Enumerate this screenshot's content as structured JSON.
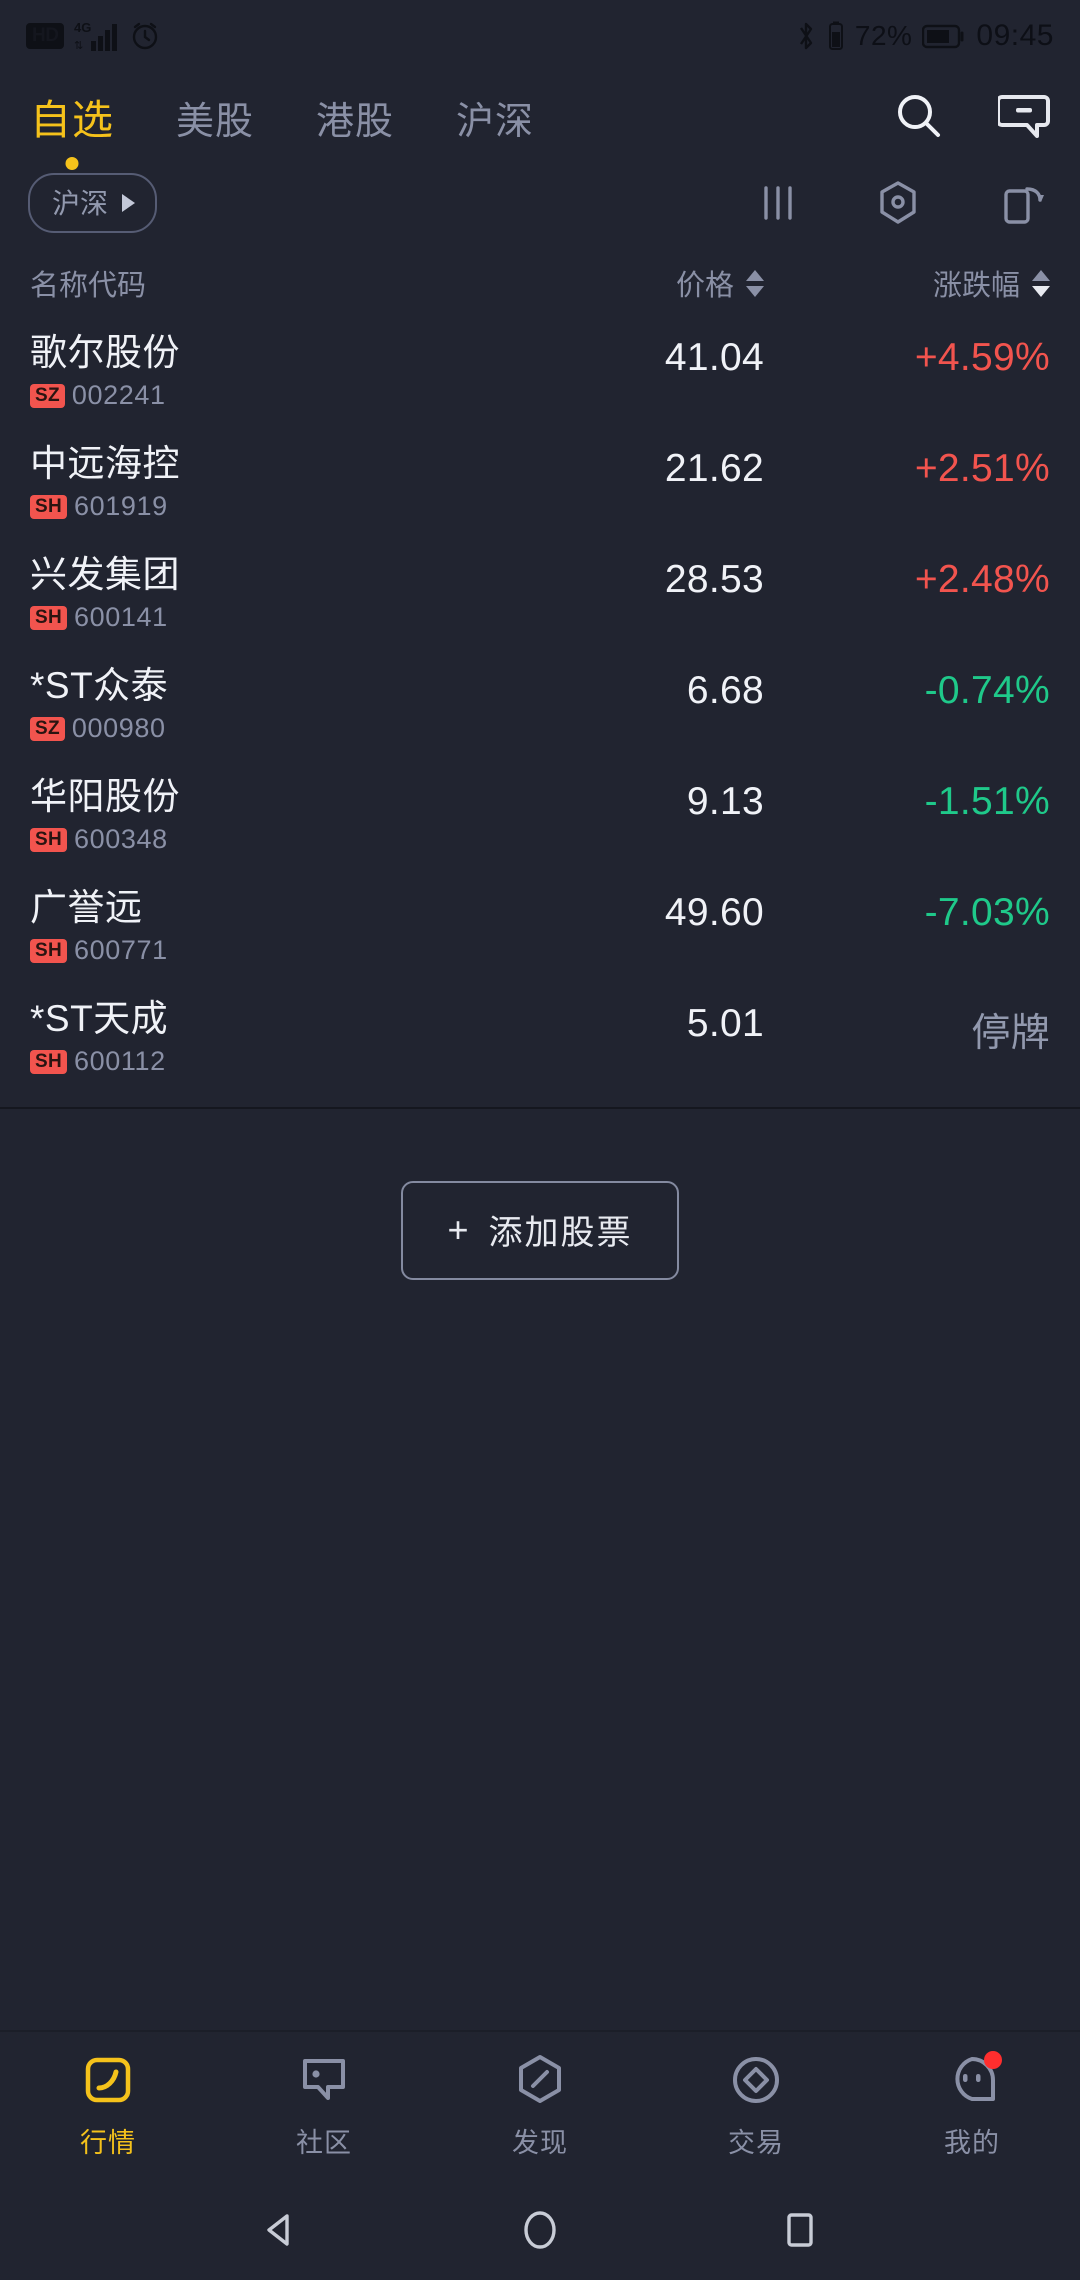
{
  "status_bar": {
    "hd_label": "HD",
    "network_label": "4G",
    "icons": [
      "hd-icon",
      "signal-4g-icon",
      "alarm-icon",
      "bluetooth-icon",
      "battery-small-icon",
      "battery-icon"
    ],
    "battery_percent": "72%",
    "time": "09:45"
  },
  "header": {
    "tabs": [
      {
        "label": "自选",
        "active": true
      },
      {
        "label": "美股",
        "active": false
      },
      {
        "label": "港股",
        "active": false
      },
      {
        "label": "沪深",
        "active": false
      }
    ],
    "search_icon": "search-icon",
    "message_icon": "message-icon"
  },
  "filter_bar": {
    "chip_label": "沪深",
    "chip_arrow": "play-triangle-icon",
    "icons": [
      "columns-icon",
      "hexagon-target-icon",
      "rotate-screen-icon"
    ]
  },
  "table": {
    "headers": {
      "name": "名称代码",
      "price": "价格",
      "change": "涨跌幅"
    },
    "sort": {
      "price_active": false,
      "change_active": true,
      "direction": "desc"
    },
    "rows": [
      {
        "name": "歌尔股份",
        "exchange": "SZ",
        "code": "002241",
        "price": "41.04",
        "change": "+4.59%",
        "dir": "up"
      },
      {
        "name": "中远海控",
        "exchange": "SH",
        "code": "601919",
        "price": "21.62",
        "change": "+2.51%",
        "dir": "up"
      },
      {
        "name": "兴发集团",
        "exchange": "SH",
        "code": "600141",
        "price": "28.53",
        "change": "+2.48%",
        "dir": "up"
      },
      {
        "name": "*ST众泰",
        "exchange": "SZ",
        "code": "000980",
        "price": "6.68",
        "change": "-0.74%",
        "dir": "down"
      },
      {
        "name": "华阳股份",
        "exchange": "SH",
        "code": "600348",
        "price": "9.13",
        "change": "-1.51%",
        "dir": "down"
      },
      {
        "name": "广誉远",
        "exchange": "SH",
        "code": "600771",
        "price": "49.60",
        "change": "-7.03%",
        "dir": "down"
      },
      {
        "name": "*ST天成",
        "exchange": "SH",
        "code": "600112",
        "price": "5.01",
        "change": "停牌",
        "dir": "flat"
      }
    ]
  },
  "add_stock": {
    "plus": "+",
    "label": "添加股票"
  },
  "bottom_nav": [
    {
      "label": "行情",
      "icon": "quotes-icon",
      "active": true,
      "badge": false
    },
    {
      "label": "社区",
      "icon": "community-icon",
      "active": false,
      "badge": false
    },
    {
      "label": "发现",
      "icon": "discover-icon",
      "active": false,
      "badge": false
    },
    {
      "label": "交易",
      "icon": "trade-icon",
      "active": false,
      "badge": false
    },
    {
      "label": "我的",
      "icon": "profile-icon",
      "active": false,
      "badge": true
    }
  ],
  "system_nav": {
    "back": "back-triangle-icon",
    "home": "home-circle-icon",
    "recents": "recents-square-icon"
  },
  "colors": {
    "background": "#212430",
    "accent": "#f5c21b",
    "up": "#f2544e",
    "down": "#1fc98a",
    "muted": "#8a90a6",
    "badge": "#f2544e"
  }
}
